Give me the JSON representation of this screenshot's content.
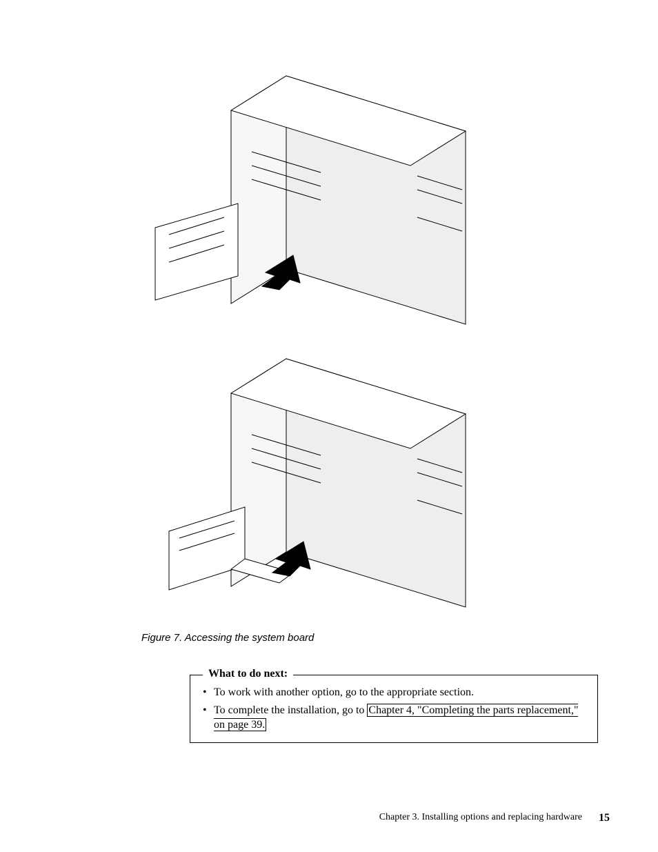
{
  "figure": {
    "caption": "Figure 7. Accessing the system board",
    "alt": "two isometric line drawings of an open desktop tower showing the expansion card bracket pivoting out to access the system board"
  },
  "next_box": {
    "legend": "What to do next:",
    "items": [
      {
        "prefix": "To work with another option, go to the appropriate section.",
        "link": null,
        "suffix": ""
      },
      {
        "prefix": "To complete the installation, go to ",
        "link": "Chapter 4, \"Completing the parts replacement,\" on page 39.",
        "suffix": ""
      }
    ]
  },
  "footer": {
    "chapter": "Chapter 3. Installing options and replacing hardware",
    "page": "15"
  }
}
